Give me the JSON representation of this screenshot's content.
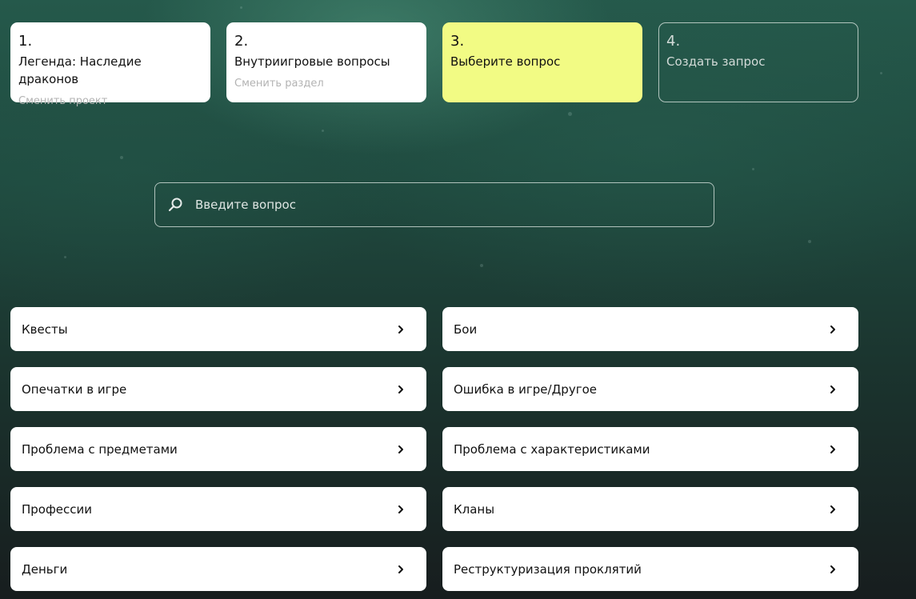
{
  "steps": [
    {
      "number": "1.",
      "title": "Легенда: Наследие драконов",
      "subtitle": "Сменить проект"
    },
    {
      "number": "2.",
      "title": "Внутриигровые вопросы",
      "subtitle": "Сменить раздел"
    },
    {
      "number": "3.",
      "title": "Выберите вопрос"
    },
    {
      "number": "4.",
      "title": "Создать запрос"
    }
  ],
  "search": {
    "placeholder": "Введите вопрос",
    "value": ""
  },
  "topics": [
    {
      "label": "Квесты"
    },
    {
      "label": "Бои"
    },
    {
      "label": "Опечатки в игре"
    },
    {
      "label": "Ошибка в игре/Другое"
    },
    {
      "label": "Проблема с предметами"
    },
    {
      "label": "Проблема с характеристиками"
    },
    {
      "label": "Профессии"
    },
    {
      "label": "Кланы"
    },
    {
      "label": "Деньги"
    },
    {
      "label": "Реструктуризация проклятий"
    }
  ],
  "colors": {
    "active_step": "#f2fb84",
    "card": "#ffffff",
    "background_top": "#25594b",
    "background_bottom": "#171d1e"
  },
  "icons": {
    "search": "search-icon",
    "topic_arrow": "chevron-right-icon"
  }
}
